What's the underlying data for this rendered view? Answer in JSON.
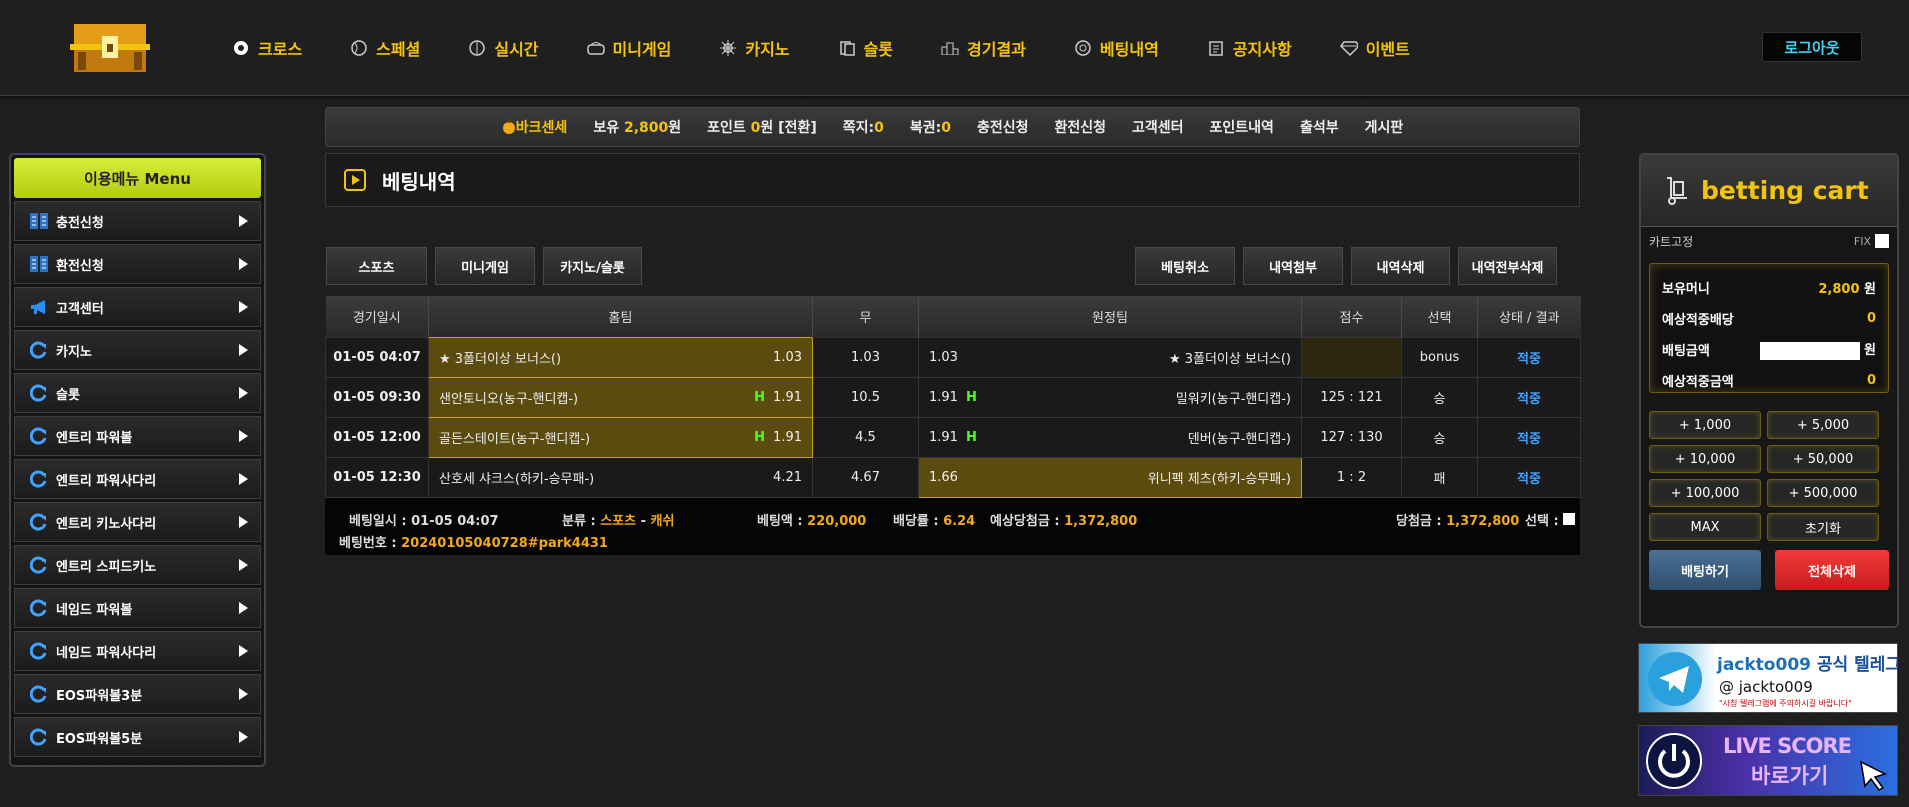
{
  "nav": [
    {
      "label": "크로스",
      "icon": "soccer-ball-icon"
    },
    {
      "label": "스페셜",
      "icon": "baseball-icon"
    },
    {
      "label": "실시간",
      "icon": "volleyball-icon"
    },
    {
      "label": "미니게임",
      "icon": "arcade-icon"
    },
    {
      "label": "카지노",
      "icon": "ship-wheel-icon"
    },
    {
      "label": "슬롯",
      "icon": "cards-icon"
    },
    {
      "label": "경기결과",
      "icon": "podium-icon"
    },
    {
      "label": "베팅내역",
      "icon": "target-icon"
    },
    {
      "label": "공지사항",
      "icon": "notice-icon"
    },
    {
      "label": "이벤트",
      "icon": "diamond-icon"
    }
  ],
  "logout": "로그아웃",
  "infobar": {
    "username": "바크센세",
    "balance_label": "보유",
    "balance_value": "2,800",
    "balance_unit": "원",
    "point_label": "포인트",
    "point_value": "0",
    "point_unit": "원 [전환]",
    "msg_label": "쪽지:",
    "msg_value": "0",
    "coupon_label": "복권:",
    "coupon_value": "0",
    "links": [
      "충전신청",
      "환전신청",
      "고객센터",
      "포인트내역",
      "출석부",
      "게시판"
    ]
  },
  "sidemenu": {
    "title": "이용메뉴   Menu",
    "items": [
      {
        "label": "충전신청",
        "icon": "deposit-icon"
      },
      {
        "label": "환전신청",
        "icon": "withdraw-icon"
      },
      {
        "label": "고객센터",
        "icon": "megaphone-icon"
      },
      {
        "label": "카지노",
        "icon": "refresh-icon"
      },
      {
        "label": "슬롯",
        "icon": "refresh-icon"
      },
      {
        "label": "엔트리 파워볼",
        "icon": "refresh-icon"
      },
      {
        "label": "엔트리 파워사다리",
        "icon": "refresh-icon"
      },
      {
        "label": "엔트리 키노사다리",
        "icon": "refresh-icon"
      },
      {
        "label": "엔트리 스피드키노",
        "icon": "refresh-icon"
      },
      {
        "label": "네임드 파워볼",
        "icon": "refresh-icon"
      },
      {
        "label": "네임드 파워사다리",
        "icon": "refresh-icon"
      },
      {
        "label": "EOS파워볼3분",
        "icon": "refresh-icon"
      },
      {
        "label": "EOS파워볼5분",
        "icon": "refresh-icon"
      }
    ]
  },
  "page_title": "베팅내역",
  "tabs_left": [
    "스포츠",
    "미니게임",
    "카지노/슬롯"
  ],
  "tabs_right": [
    "베팅취소",
    "내역첨부",
    "내역삭제",
    "내역전부삭제"
  ],
  "table": {
    "headers": [
      "경기일시",
      "홈팀",
      "무",
      "원정팀",
      "점수",
      "선택",
      "상태 / 결과"
    ],
    "rows": [
      {
        "date": "01-05 04:07",
        "home": "★ 3폴더이상 보너스()",
        "home_h": false,
        "home_odds": "1.03",
        "draw": "1.03",
        "away_odds": "1.03",
        "away_h": false,
        "away": "★ 3폴더이상 보너스()",
        "score": "",
        "pick": "bonus",
        "status": "적중",
        "selected": "home"
      },
      {
        "date": "01-05 09:30",
        "home": "샌안토니오(농구-핸디캡-)",
        "home_h": true,
        "home_odds": "1.91",
        "draw": "10.5",
        "away_odds": "1.91",
        "away_h": true,
        "away": "밀워키(농구-핸디캡-)",
        "score": "125 : 121",
        "pick": "승",
        "status": "적중",
        "selected": "home"
      },
      {
        "date": "01-05 12:00",
        "home": "골든스테이트(농구-핸디캡-)",
        "home_h": true,
        "home_odds": "1.91",
        "draw": "4.5",
        "away_odds": "1.91",
        "away_h": true,
        "away": "덴버(농구-핸디캡-)",
        "score": "127 : 130",
        "pick": "승",
        "status": "적중",
        "selected": "home"
      },
      {
        "date": "01-05 12:30",
        "home": "산호세 샤크스(하키-승무패-)",
        "home_h": false,
        "home_odds": "4.21",
        "draw": "4.67",
        "away_odds": "1.66",
        "away_h": false,
        "away": "위니펙 제츠(하키-승무패-)",
        "score": "1 : 2",
        "pick": "패",
        "status": "적중",
        "selected": "away"
      }
    ]
  },
  "summary": {
    "bet_time_label": "베팅일시 :",
    "bet_time": "01-05 04:07",
    "category_label": "분류 :",
    "category_a": "스포츠",
    "category_sep": "-",
    "category_b": "캐쉬",
    "amount_label": "베팅액 :",
    "amount": "220,000",
    "rate_label": "배당률 :",
    "rate": "6.24",
    "expected_label": "예상당첨금 :",
    "expected": "1,372,800",
    "win_label": "당첨금 :",
    "win": "1,372,800",
    "select_label": "선택 :",
    "bet_no_label": "베팅번호 :",
    "bet_no": "20240105040728#park4431"
  },
  "cart": {
    "title": "betting cart",
    "fix_label": "카트고정",
    "fix_text": "FIX",
    "money_label": "보유머니",
    "money_value": "2,800",
    "money_unit": "원",
    "exp_rate_label": "예상적중배당",
    "exp_rate": "0",
    "bet_amount_label": "배팅금액",
    "bet_amount_unit": "원",
    "exp_win_label": "예상적중금액",
    "exp_win": "0",
    "chips": [
      "+ 1,000",
      "+ 5,000",
      "+ 10,000",
      "+ 50,000",
      "+ 100,000",
      "+ 500,000",
      "MAX",
      "초기화"
    ],
    "bet_button": "배팅하기",
    "clear_button": "전체삭제"
  },
  "banner_tg": {
    "line1a": "jackto009",
    "line1b": "공식 텔레그램",
    "handle": "@ jackto009",
    "note": "\"사칭 텔레그램에 주의하시길 바랍니다\""
  },
  "banner_live": {
    "line1": "LIVE SCORE",
    "line2": "바로가기"
  },
  "colors": {
    "accent": "#f3c30d",
    "status": "#3fa3ff",
    "h_mark": "#4dff2a"
  }
}
